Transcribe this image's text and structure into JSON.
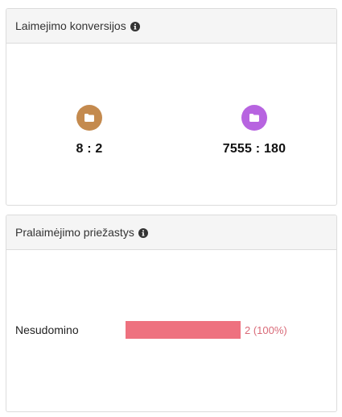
{
  "colors": {
    "conversion_left": "#c48a4e",
    "conversion_right": "#b764e0",
    "reason_bar": "#ee717f",
    "reason_value_text": "#d96a78"
  },
  "conversions_panel": {
    "title": "Laimejimo konversijos",
    "info_icon": "info-circle-icon",
    "stats": [
      {
        "icon": "folder-icon",
        "value": "8 : 2"
      },
      {
        "icon": "folder-icon",
        "value": "7555 : 180"
      }
    ]
  },
  "loss_reasons_panel": {
    "title": "Pralaimėjimo priežastys",
    "info_icon": "info-circle-icon",
    "reasons": [
      {
        "label": "Nesudomino",
        "fraction": 1.0,
        "value_text": "2 (100%)"
      }
    ]
  }
}
